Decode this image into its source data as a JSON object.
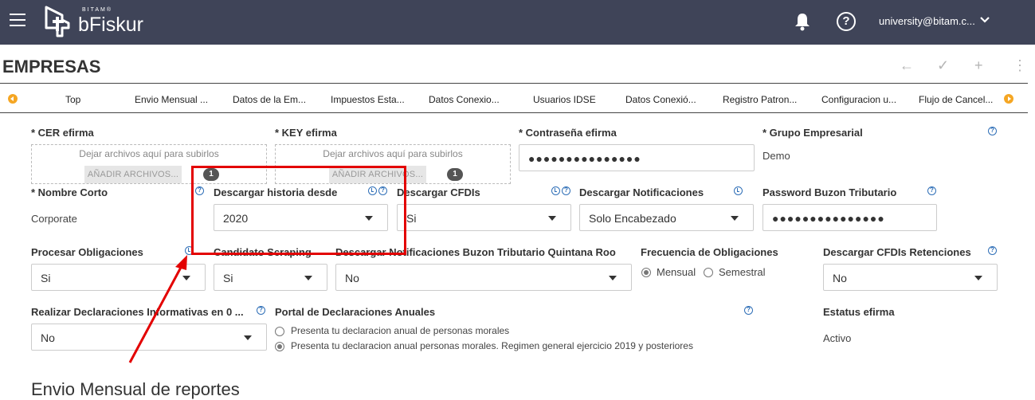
{
  "header": {
    "brand_small": "BITAM®",
    "brand": "bFiskur",
    "user": "university@bitam.c..."
  },
  "page": {
    "title": "EMPRESAS",
    "actions": [
      "←",
      "✓",
      "+",
      "⋮"
    ]
  },
  "tabs": [
    "Top",
    "Envio Mensual ...",
    "Datos de la Em...",
    "Impuestos Esta...",
    "Datos Conexio...",
    "Usuarios IDSE",
    "Datos Conexió...",
    "Registro Patron...",
    "Configuracion u...",
    "Flujo de Cancel..."
  ],
  "form": {
    "cer": {
      "label": "* CER efirma",
      "drop": "Dejar archivos aquí para subirlos",
      "button": "AÑADIR ARCHIVOS...",
      "count": "1"
    },
    "key": {
      "label": "* KEY efirma",
      "drop": "Dejar archivos aquí para subirlos",
      "button": "AÑADIR ARCHIVOS...",
      "count": "1"
    },
    "password": {
      "label": "* Contraseña efirma",
      "value": "●●●●●●●●●●●●●●●"
    },
    "grupo": {
      "label": "* Grupo Empresarial",
      "value": "Demo"
    },
    "nombre_corto": {
      "label": "* Nombre Corto",
      "value": "Corporate"
    },
    "historia": {
      "label": "Descargar historia desde",
      "value": "2020"
    },
    "cfdis": {
      "label": "Descargar CFDIs",
      "value": "Si"
    },
    "notificaciones": {
      "label": "Descargar Notificaciones",
      "value": "Solo Encabezado"
    },
    "buzon_pwd": {
      "label": "Password Buzon Tributario",
      "value": "●●●●●●●●●●●●●●●"
    },
    "procesar": {
      "label": "Procesar Obligaciones",
      "value": "Si"
    },
    "scraping": {
      "label": "Candidato Scraping",
      "value": "Si"
    },
    "buzon_qr": {
      "label": "Descargar Notificaciones Buzon Tributario Quintana Roo",
      "value": "No"
    },
    "frecuencia": {
      "label": "Frecuencia de Obligaciones",
      "options": [
        "Mensual",
        "Semestral"
      ]
    },
    "retenciones": {
      "label": "Descargar CFDIs Retenciones",
      "value": "No"
    },
    "informativas": {
      "label": "Realizar Declaraciones Informativas en 0 ...",
      "value": "No"
    },
    "portal": {
      "label": "Portal de Declaraciones Anuales",
      "options": [
        "Presenta tu declaracion anual de personas morales",
        "Presenta tu declaracion anual personas morales. Regimen general ejercicio 2019 y posteriores"
      ]
    },
    "estatus": {
      "label": "Estatus efirma",
      "value": "Activo"
    }
  },
  "section": {
    "title": "Envio Mensual de reportes"
  },
  "colors": {
    "topbar": "#3f4458",
    "accent": "#f5a623",
    "help": "#2f6fb7",
    "annotation": "#e30000"
  }
}
